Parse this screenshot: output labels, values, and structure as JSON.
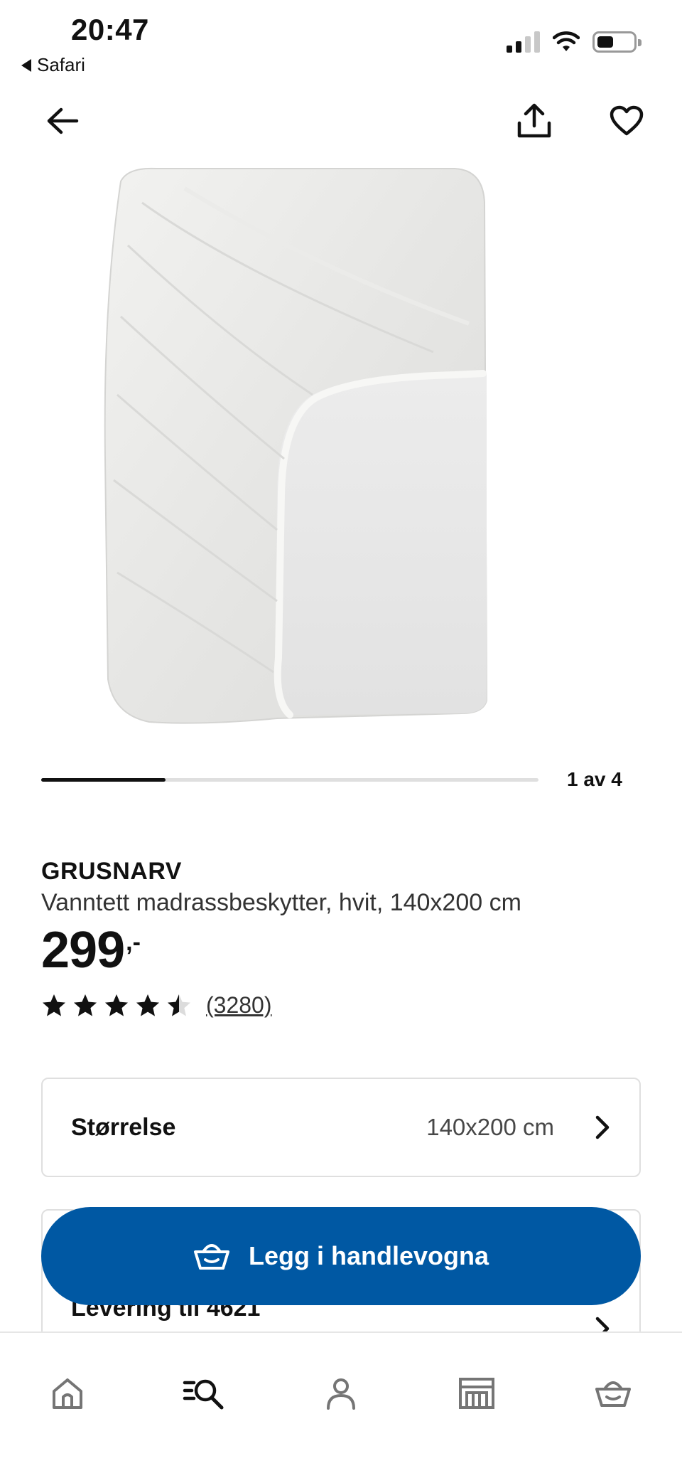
{
  "status_bar": {
    "time": "20:47",
    "back_app": "Safari",
    "battery_level": 0.35,
    "signal_bars_active": 2,
    "signal_bars_total": 4
  },
  "toolbar": {
    "back_icon": "arrow-left-icon",
    "share_icon": "share-icon",
    "favorite_icon": "heart-icon"
  },
  "carousel": {
    "current": 1,
    "total": 4,
    "label": "1 av 4"
  },
  "product": {
    "name": "GRUSNARV",
    "description": "Vanntett madrassbeskytter, hvit, 140x200 cm",
    "price": "299",
    "price_suffix": ",-",
    "rating": 4.5,
    "rating_max": 5,
    "review_count": "(3280)"
  },
  "size_selector": {
    "label": "Størrelse",
    "value": "140x200 cm"
  },
  "delivery": {
    "label": "Levering til 4621"
  },
  "cart_button": {
    "label": "Legg i handlevogna",
    "icon": "basket-icon"
  },
  "bottom_nav": {
    "items": [
      {
        "icon": "home-icon"
      },
      {
        "icon": "search-icon",
        "active": true
      },
      {
        "icon": "profile-icon"
      },
      {
        "icon": "store-icon"
      },
      {
        "icon": "basket-icon"
      }
    ]
  },
  "colors": {
    "brand_blue": "#0058a3",
    "text": "#111111",
    "border": "#dfdfdf"
  }
}
